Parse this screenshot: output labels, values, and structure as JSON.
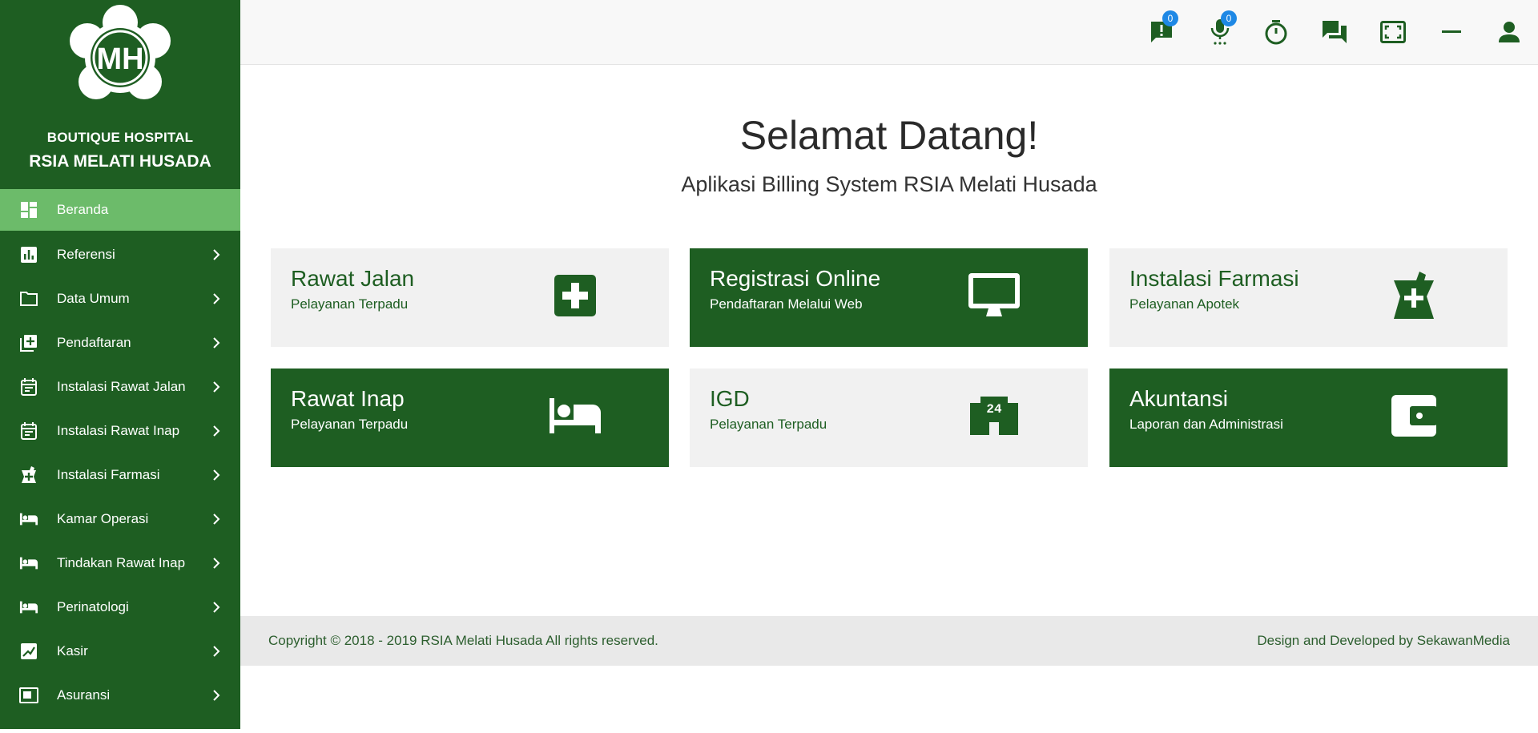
{
  "brand": {
    "subtitle": "BOUTIQUE HOSPITAL",
    "name": "RSIA MELATI HUSADA",
    "logo_letters": "MH"
  },
  "sidebar": {
    "items": [
      {
        "label": "Beranda",
        "icon": "dashboard-icon",
        "active": true,
        "has_submenu": false
      },
      {
        "label": "Referensi",
        "icon": "chart-icon",
        "has_submenu": true
      },
      {
        "label": "Data Umum",
        "icon": "folder-icon",
        "has_submenu": true
      },
      {
        "label": "Pendaftaran",
        "icon": "add-document-icon",
        "has_submenu": true
      },
      {
        "label": "Instalasi Rawat Jalan",
        "icon": "calendar-icon",
        "has_submenu": true
      },
      {
        "label": "Instalasi Rawat Inap",
        "icon": "calendar-icon",
        "has_submenu": true
      },
      {
        "label": "Instalasi Farmasi",
        "icon": "pharmacy-icon",
        "has_submenu": true
      },
      {
        "label": "Kamar Operasi",
        "icon": "bed-icon",
        "has_submenu": true
      },
      {
        "label": "Tindakan Rawat Inap",
        "icon": "bed-icon",
        "has_submenu": true
      },
      {
        "label": "Perinatologi",
        "icon": "bed-icon",
        "has_submenu": true
      },
      {
        "label": "Kasir",
        "icon": "cashier-icon",
        "has_submenu": true
      },
      {
        "label": "Asuransi",
        "icon": "card-icon",
        "has_submenu": true
      }
    ]
  },
  "topbar": {
    "notification_count": "0",
    "voice_count": "0",
    "icons": [
      "notification-icon",
      "mic-icon",
      "timer-icon",
      "chat-icon",
      "fullscreen-icon",
      "minimize-icon",
      "user-icon"
    ]
  },
  "main": {
    "title": "Selamat Datang!",
    "subtitle": "Aplikasi Billing System RSIA Melati Husada",
    "cards": [
      {
        "title": "Rawat Jalan",
        "subtitle": "Pelayanan Terpadu",
        "icon": "medical-plus-icon",
        "style": "light"
      },
      {
        "title": "Registrasi Online",
        "subtitle": "Pendaftaran Melalui Web",
        "icon": "monitor-icon",
        "style": "dark"
      },
      {
        "title": "Instalasi Farmasi",
        "subtitle": "Pelayanan Apotek",
        "icon": "pharmacy-icon",
        "style": "light"
      },
      {
        "title": "Rawat Inap",
        "subtitle": "Pelayanan Terpadu",
        "icon": "bed-icon",
        "style": "dark"
      },
      {
        "title": "IGD",
        "subtitle": "Pelayanan Terpadu",
        "icon": "hospital-24-icon",
        "style": "light"
      },
      {
        "title": "Akuntansi",
        "subtitle": "Laporan dan Administrasi",
        "icon": "wallet-icon",
        "style": "dark"
      }
    ]
  },
  "footer": {
    "copyright": "Copyright © 2018 - 2019 RSIA Melati Husada All rights reserved.",
    "credit": "Design and Developed by SekawanMedia"
  },
  "colors": {
    "primary": "#1e5e22",
    "active": "#6cbb6a",
    "light_card": "#f1f1f1",
    "badge": "#1e88e5"
  }
}
